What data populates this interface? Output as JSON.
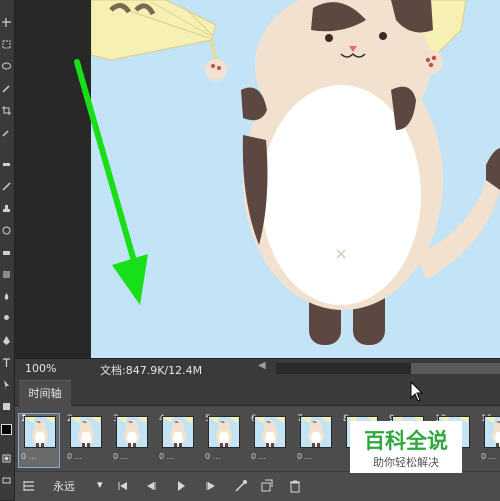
{
  "colors": {
    "panel": "#3a3a3a",
    "canvas_bg": "#c3e3f6",
    "accent_green": "#18e018",
    "watermark_green": "#2fa83c"
  },
  "status": {
    "zoom": "100%",
    "doc_info": "文档:847.9K/12.4M"
  },
  "timeline": {
    "tab_label": "时间轴",
    "frames": [
      {
        "num": "1",
        "delay": "0 ..."
      },
      {
        "num": "2",
        "delay": "0 ..."
      },
      {
        "num": "3",
        "delay": "0 ..."
      },
      {
        "num": "4",
        "delay": "0 ..."
      },
      {
        "num": "5",
        "delay": "0 ..."
      },
      {
        "num": "6",
        "delay": "0 ..."
      },
      {
        "num": "7",
        "delay": "0 ..."
      },
      {
        "num": "8",
        "delay": ""
      },
      {
        "num": "9",
        "delay": ""
      },
      {
        "num": "10",
        "delay": ""
      },
      {
        "num": "11",
        "delay": "0 ..."
      }
    ],
    "selected_frame": 1,
    "loop_option": "永远",
    "controls": [
      "first-frame-icon",
      "prev-frame-icon",
      "play-icon",
      "next-frame-icon",
      "tween-icon",
      "duplicate-frame-icon",
      "delete-frame-icon"
    ]
  },
  "watermark": {
    "title": "百科全说",
    "subtitle": "助你轻松解决"
  }
}
